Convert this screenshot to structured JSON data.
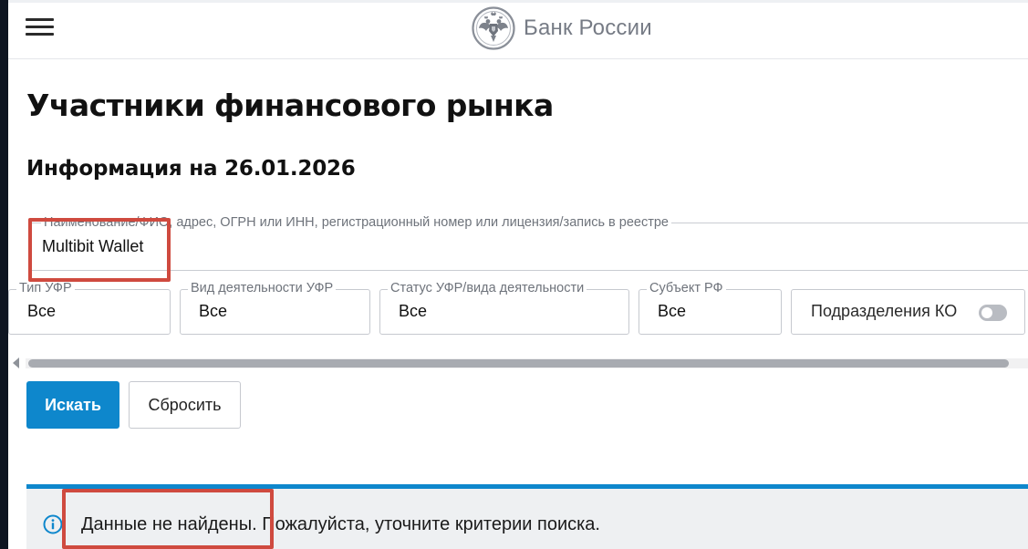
{
  "header": {
    "brand_name": "Банк России",
    "menu_icon": "hamburger-menu-icon",
    "logo_icon": "double-headed-eagle-emblem-icon"
  },
  "page": {
    "title": "Участники финансового рынка",
    "info_date": "Информация на 26.01.2026"
  },
  "search": {
    "label": "Наименование/ФИО, адрес, ОГРН или ИНН, регистрационный номер или лицензия/запись в реестре",
    "value": "Multibit Wallet"
  },
  "filters": [
    {
      "label": "Тип УФР",
      "value": "Все"
    },
    {
      "label": "Вид деятельности УФР",
      "value": "Все"
    },
    {
      "label": "Статус УФР/вида деятельности",
      "value": "Все"
    },
    {
      "label": "Субъект РФ",
      "value": "Все"
    }
  ],
  "toggle": {
    "label": "Подразделения КО",
    "enabled": false
  },
  "buttons": {
    "search_label": "Искать",
    "reset_label": "Сбросить"
  },
  "result": {
    "icon": "info-circle-icon",
    "message": "Данные не найдены. Пожалуйста, уточните критерии поиска."
  },
  "colors": {
    "accent": "#0e87cc",
    "annotation": "#cf4a3f",
    "notice_background": "#eef0f2",
    "brand_text": "#767b85"
  }
}
